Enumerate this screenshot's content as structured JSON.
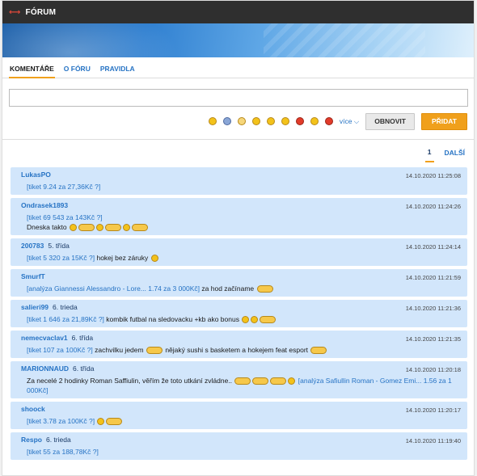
{
  "header": {
    "title": "FÓRUM"
  },
  "tabs": [
    {
      "label": "KOMENTÁŘE",
      "active": true
    },
    {
      "label": "O FÓRU",
      "active": false
    },
    {
      "label": "PRAVIDLA",
      "active": false
    }
  ],
  "compose": {
    "value": ""
  },
  "toolbar": {
    "more_label": "více",
    "refresh_label": "OBNOVIT",
    "add_label": "PŘIDAT"
  },
  "pager": {
    "current": "1",
    "next": "DALŠÍ"
  },
  "posts": [
    {
      "user": "LukasPO",
      "rank": "",
      "time": "14.10.2020 11:25:08",
      "parts": [
        {
          "link": "[tiket 9.24 za 27,36Kč ?]"
        }
      ]
    },
    {
      "user": "Ondrasek1893",
      "rank": "",
      "time": "14.10.2020 11:24:26",
      "parts": [
        {
          "link": "[tiket 69 543 za 143Kč ?]"
        },
        {
          "br": true
        },
        {
          "text": "Dneska takto "
        },
        {
          "emo": "grin"
        },
        {
          "emo": "wide"
        },
        {
          "emo": "grin"
        },
        {
          "emo": "wide"
        },
        {
          "emo": "grin"
        },
        {
          "emo": "wide"
        }
      ]
    },
    {
      "user": "200783",
      "rank": "5. třída",
      "time": "14.10.2020 11:24:14",
      "parts": [
        {
          "link": "[tiket 5 320 za 15Kč ?]"
        },
        {
          "text": " hokej bez záruky "
        },
        {
          "emo": "cool"
        }
      ]
    },
    {
      "user": "SmurfT",
      "rank": "",
      "time": "14.10.2020 11:21:59",
      "parts": [
        {
          "link": "[analýza Giannessi Alessandro - Lore... 1.74 za 3 000Kč]"
        },
        {
          "text": " za hod začíname "
        },
        {
          "emo": "wide"
        }
      ]
    },
    {
      "user": "salieri99",
      "rank": "6. trieda",
      "time": "14.10.2020 11:21:36",
      "parts": [
        {
          "link": "[tiket 1 646 za 21,89Kč ?]"
        },
        {
          "text": " kombik futbal na sledovacku +kb ako bonus "
        },
        {
          "emo": "grin"
        },
        {
          "emo": "grin"
        },
        {
          "emo": "wide"
        }
      ]
    },
    {
      "user": "nemecvaclav1",
      "rank": "6. třída",
      "time": "14.10.2020 11:21:35",
      "parts": [
        {
          "link": "[tiket 107 za 100Kč ?]"
        },
        {
          "text": " zachvilku jedem "
        },
        {
          "emo": "wide"
        },
        {
          "text": " nějaký sushi s basketem a hokejem feat esport "
        },
        {
          "emo": "wide"
        }
      ]
    },
    {
      "user": "MARIONNAUD",
      "rank": "6. třída",
      "time": "14.10.2020 11:20:18",
      "parts": [
        {
          "text": "Za necelé 2 hodinky Roman Saffiulin, věřím že toto utkání zvládne.. "
        },
        {
          "emo": "wide"
        },
        {
          "emo": "wide"
        },
        {
          "emo": "wide"
        },
        {
          "emo": "grin"
        },
        {
          "link": " [analýza Safiullin Roman - Gomez Emi... 1.56 za 1 000Kč]"
        }
      ]
    },
    {
      "user": "shoock",
      "rank": "",
      "time": "14.10.2020 11:20:17",
      "parts": [
        {
          "link": "[tiket 3.78 za 100Kč ?]"
        },
        {
          "text": " "
        },
        {
          "emo": "grin"
        },
        {
          "emo": "wide"
        }
      ]
    },
    {
      "user": "Respo",
      "rank": "6. trieda",
      "time": "14.10.2020 11:19:40",
      "parts": [
        {
          "link": "[tiket 55 za 188,78Kč ?]"
        }
      ]
    }
  ]
}
